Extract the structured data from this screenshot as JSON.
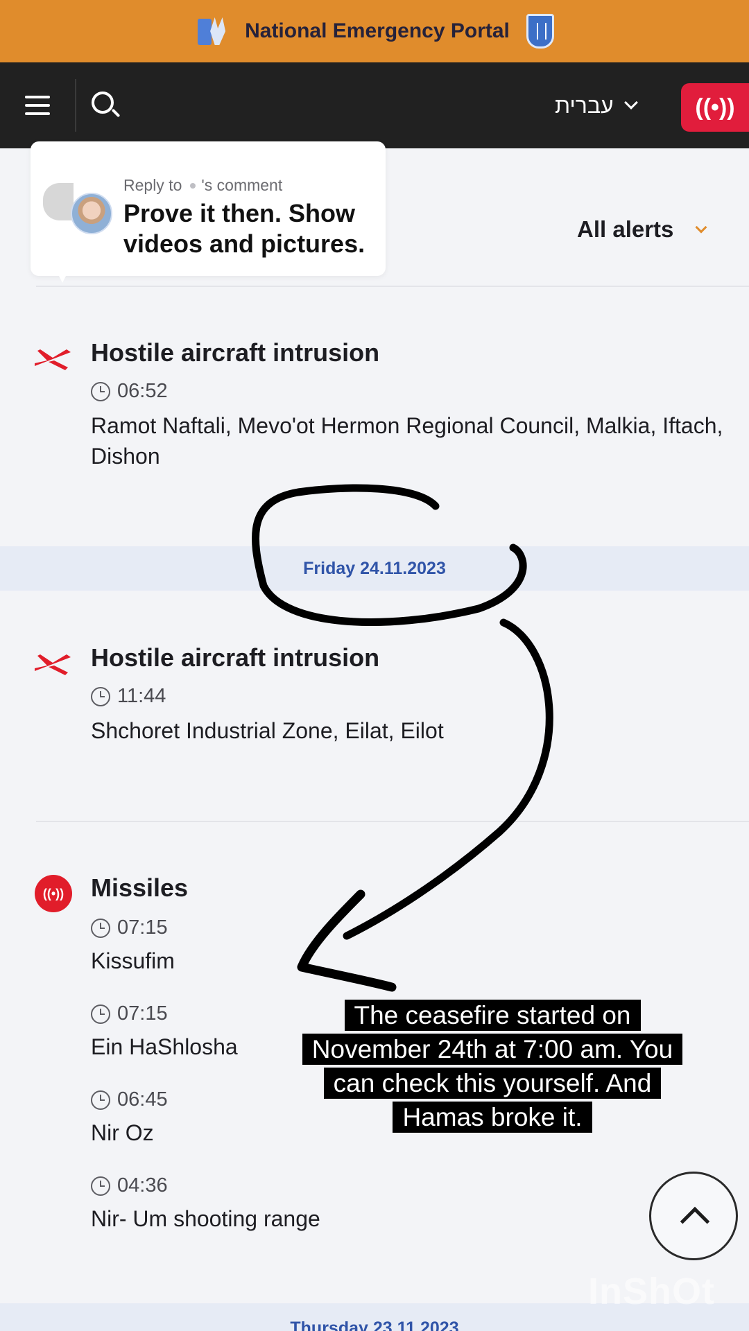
{
  "header": {
    "title": "National Emergency Portal"
  },
  "navbar": {
    "language": "עברית",
    "live_icon": "((•))"
  },
  "filter": {
    "label": "All alerts"
  },
  "reply": {
    "prefix": "Reply to",
    "suffix": "'s comment",
    "text": "Prove it then. Show videos and pictures."
  },
  "alerts": [
    {
      "title": "Hostile aircraft intrusion",
      "time": "06:52",
      "location": "Ramot Naftali, Mevo'ot Hermon Regional Council, Malkia, Iftach, Dishon"
    },
    {
      "title": "Hostile aircraft intrusion",
      "time": "11:44",
      "location": "Shchoret Industrial Zone, Eilat, Eilot"
    },
    {
      "title": "Missiles",
      "entries": [
        {
          "time": "07:15",
          "location": "Kissufim"
        },
        {
          "time": "07:15",
          "location": "Ein HaShlosha"
        },
        {
          "time": "06:45",
          "location": "Nir Oz"
        },
        {
          "time": "04:36",
          "location": "Nir- Um shooting range"
        }
      ]
    }
  ],
  "dates": {
    "friday": "Friday 24.11.2023",
    "thursday": "Thursday 23.11.2023"
  },
  "caption": "The ceasefire started on November 24th at 7:00 am. You can check this yourself. And Hamas broke it.",
  "watermark": "InShOt",
  "colors": {
    "accent": "#e08c2c",
    "navbar": "#212121",
    "alert_red": "#e11d2a",
    "date_blue": "#3054a8"
  },
  "icons": [
    "menu-icon",
    "search-icon",
    "chevron-down-icon",
    "live-alert-icon",
    "aircraft-icon",
    "clock-icon",
    "missile-alert-icon",
    "chevron-up-icon"
  ]
}
